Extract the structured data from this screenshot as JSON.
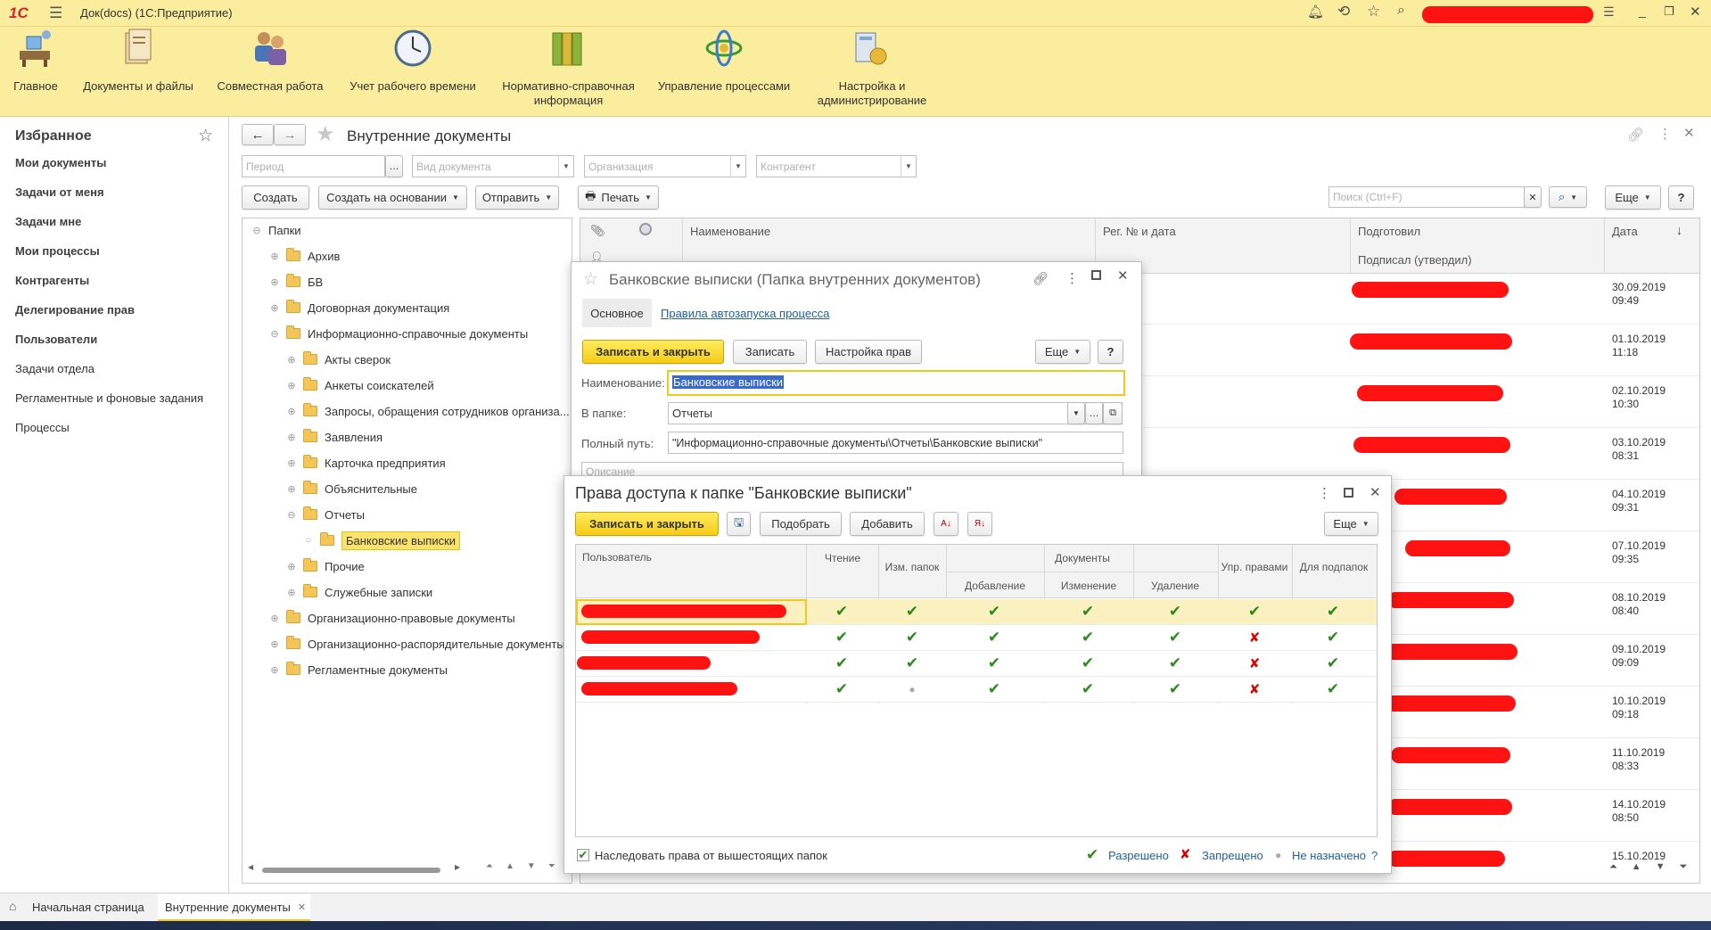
{
  "app": {
    "logo": "1С",
    "title": "Док(docs)  (1С:Предприятие)"
  },
  "sections": [
    {
      "label": "Главное",
      "icon": "home-desk-icon"
    },
    {
      "label": "Документы и файлы",
      "icon": "documents-icon"
    },
    {
      "label": "Совместная работа",
      "icon": "users-icon"
    },
    {
      "label": "Учет рабочего времени",
      "icon": "clock-icon"
    },
    {
      "label": "Нормативно-справочная информация",
      "icon": "binders-icon"
    },
    {
      "label": "Управление процессами",
      "icon": "process-icon"
    },
    {
      "label": "Настройка и администрирование",
      "icon": "admin-icon"
    }
  ],
  "favorites": {
    "title": "Избранное",
    "items": [
      {
        "label": "Мои документы"
      },
      {
        "label": "Задачи от меня"
      },
      {
        "label": "Задачи мне"
      },
      {
        "label": "Мои процессы"
      },
      {
        "label": "Контрагенты"
      },
      {
        "label": "Делегирование прав"
      },
      {
        "label": "Пользователи"
      },
      {
        "label": "Задачи отдела"
      },
      {
        "label": "Регламентные и фоновые задания"
      },
      {
        "label": "Процессы"
      }
    ]
  },
  "page": {
    "title": "Внутренние документы"
  },
  "filters": {
    "period": "Период",
    "kind": "Вид документа",
    "org": "Организация",
    "contractor": "Контрагент"
  },
  "toolbar": {
    "create": "Создать",
    "create_based": "Создать на основании",
    "send": "Отправить",
    "print": "Печать",
    "search": "Поиск (Ctrl+F)",
    "more": "Еще",
    "help": "?"
  },
  "tree": {
    "root": "Папки",
    "items": [
      {
        "label": "Архив",
        "level": 1
      },
      {
        "label": "БВ",
        "level": 1
      },
      {
        "label": "Договорная документация",
        "level": 1
      },
      {
        "label": "Информационно-справочные документы",
        "level": 1
      },
      {
        "label": "Акты сверок",
        "level": 2
      },
      {
        "label": "Анкеты соискателей",
        "level": 2
      },
      {
        "label": "Запросы, обращения сотрудников организа...",
        "level": 2
      },
      {
        "label": "Заявления",
        "level": 2
      },
      {
        "label": "Карточка предприятия",
        "level": 2
      },
      {
        "label": "Объяснительные",
        "level": 2
      },
      {
        "label": "Отчеты",
        "level": 2
      },
      {
        "label": "Банковские выписки",
        "level": 3
      },
      {
        "label": "Прочие",
        "level": 2
      },
      {
        "label": "Служебные записки",
        "level": 2
      },
      {
        "label": "Организационно-правовые документы",
        "level": 1
      },
      {
        "label": "Организационно-распорядительные документы",
        "level": 1
      },
      {
        "label": "Регламентные документы",
        "level": 1
      }
    ]
  },
  "list": {
    "columns": {
      "name": "Наименование",
      "reg": "Рег. № и дата",
      "prepared": "Подготовил",
      "signed": "Подписал (утвердил)",
      "date": "Дата"
    },
    "dates": [
      [
        "30.09.2019",
        "09:49"
      ],
      [
        "01.10.2019",
        "11:18"
      ],
      [
        "02.10.2019",
        "10:30"
      ],
      [
        "03.10.2019",
        "08:31"
      ],
      [
        "04.10.2019",
        "09:31"
      ],
      [
        "07.10.2019",
        "09:35"
      ],
      [
        "08.10.2019",
        "08:40"
      ],
      [
        "09.10.2019",
        "09:09"
      ],
      [
        "10.10.2019",
        "09:18"
      ],
      [
        "11.10.2019",
        "08:33"
      ],
      [
        "14.10.2019",
        "08:50"
      ],
      [
        "15.10.2019",
        ""
      ]
    ]
  },
  "folder_dialog": {
    "title": "Банковские выписки (Папка внутренних документов)",
    "tab_main": "Основное",
    "tab_rules": "Правила автозапуска процесса",
    "save_close": "Записать и закрыть",
    "save": "Записать",
    "rights": "Настройка прав",
    "more": "Еще",
    "help": "?",
    "name_label": "Наименование:",
    "name_value": "Банковские выписки",
    "parent_label": "В папке:",
    "parent_value": "Отчеты",
    "path_label": "Полный путь:",
    "path_value": "\"Информационно-справочные документы\\Отчеты\\Банковские выписки\"",
    "desc_placeholder": "Описание"
  },
  "rights_dialog": {
    "title": "Права доступа к папке \"Банковские выписки\"",
    "save_close": "Записать и закрыть",
    "pick": "Подобрать",
    "add": "Добавить",
    "more": "Еще",
    "columns": {
      "user": "Пользователь",
      "read": "Чтение",
      "folders": "Изм. папок",
      "docs": "Документы",
      "add": "Добавление",
      "edit": "Изменение",
      "delete": "Удаление",
      "manage": "Упр. правами",
      "sub": "Для подпапок"
    },
    "rows": [
      [
        "allow",
        "allow",
        "allow",
        "allow",
        "allow",
        "allow",
        "allow"
      ],
      [
        "allow",
        "allow",
        "allow",
        "allow",
        "allow",
        "deny",
        "allow"
      ],
      [
        "allow",
        "allow",
        "allow",
        "allow",
        "allow",
        "deny",
        "allow"
      ],
      [
        "allow",
        "none",
        "allow",
        "allow",
        "allow",
        "deny",
        "allow"
      ]
    ],
    "inherit": "Наследовать права от вышестоящих папок",
    "legend_allow": "Разрешено",
    "legend_deny": "Запрещено",
    "legend_none": "Не назначено",
    "legend_q": "?"
  },
  "bottom_tabs": {
    "home": "Начальная страница",
    "current": "Внутренние документы"
  },
  "colors": {
    "header": "#fbed9e",
    "accent": "#f5cc16",
    "allow": "#2d8a1c",
    "deny": "#e00000"
  }
}
